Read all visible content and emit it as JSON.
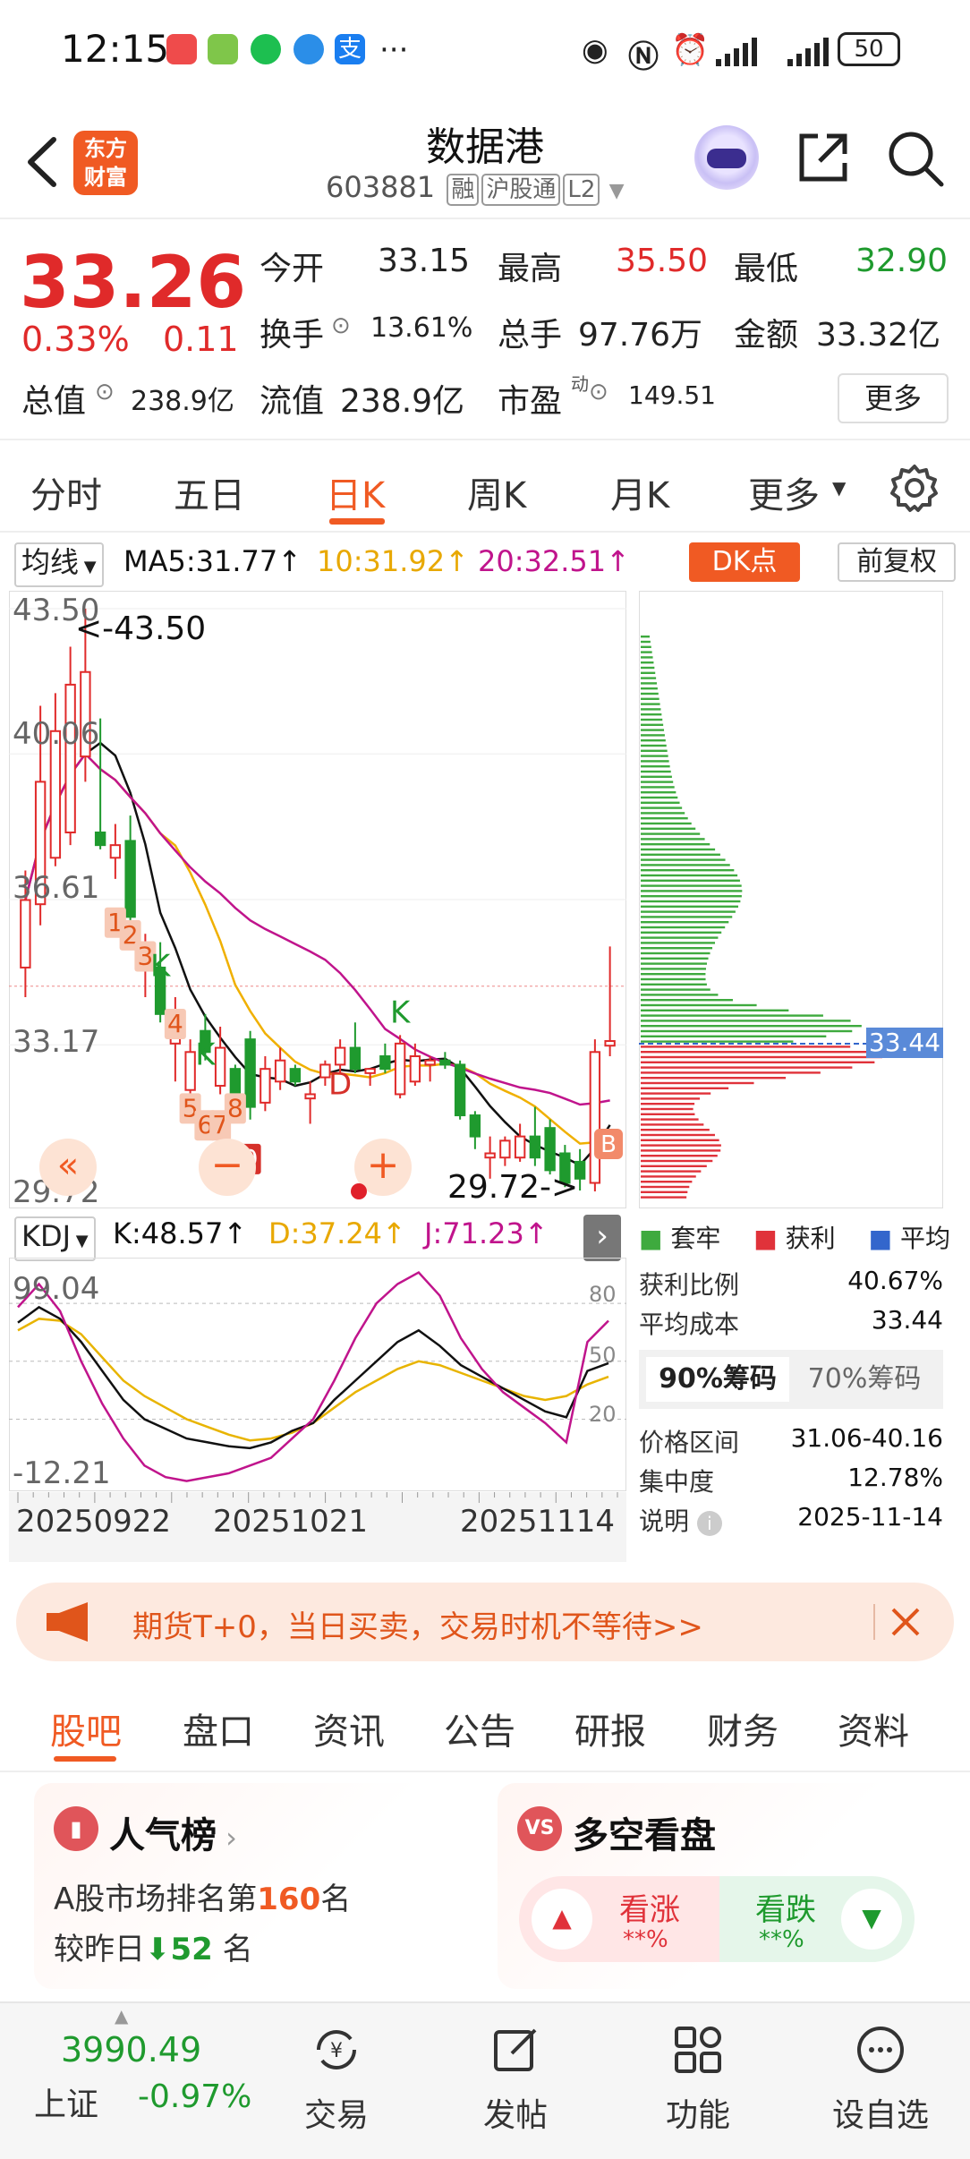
{
  "status_bar": {
    "time": "12:15",
    "battery": "50",
    "icons": [
      "notification-app-icon",
      "wifi-app-icon",
      "wechat-icon",
      "location-icon",
      "alipay-icon",
      "more-dots-icon",
      "eye-icon",
      "nfc-icon",
      "alarm-icon",
      "signal-icon",
      "signal-icon"
    ]
  },
  "header": {
    "name": "数据港",
    "code": "603881",
    "tags": [
      "融",
      "沪股通",
      "L2"
    ],
    "brand": "东方财富"
  },
  "quote": {
    "price": "33.26",
    "change_pct": "0.33%",
    "change": "0.11",
    "open_label": "今开",
    "open": "33.15",
    "high_label": "最高",
    "high": "35.50",
    "low_label": "最低",
    "low": "32.90",
    "turnover_label": "换手",
    "turnover": "13.61%",
    "volume_label": "总手",
    "volume": "97.76万",
    "amount_label": "金额",
    "amount": "33.32亿",
    "mktcap_label": "总值",
    "mktcap": "238.9亿",
    "float_label": "流值",
    "float": "238.9亿",
    "pe_label": "市盈",
    "pe_sup": "动",
    "pe": "149.51",
    "more": "更多"
  },
  "periods": [
    "分时",
    "五日",
    "日K",
    "周K",
    "月K",
    "更多"
  ],
  "ma_row": {
    "selector": "均线",
    "ma5": "MA5:31.77↑",
    "ma10": "10:31.92↑",
    "ma20": "20:32.51↑",
    "dk": "DK点",
    "adjust": "前复权"
  },
  "kchart": {
    "y_labels": [
      "43.50",
      "40.06",
      "36.61",
      "33.17",
      "29.72"
    ],
    "high_marker": "<-43.50",
    "low_marker": "29.72->",
    "td_numbers": [
      "1",
      "2",
      "3",
      "4",
      "5",
      "6",
      "7",
      "8",
      "9"
    ],
    "letters": [
      "K",
      "K",
      "K",
      "D"
    ],
    "b_marker": "B",
    "colors": {
      "up": "#e02a2a",
      "down": "#1f9a2e",
      "ma5": "#111111",
      "ma10": "#f0b000",
      "ma20": "#c0148c"
    }
  },
  "chart_data": {
    "type": "candlestick",
    "ylim": [
      29.72,
      43.5
    ],
    "candles": [
      {
        "o": 35.0,
        "h": 37.3,
        "l": 34.3,
        "c": 36.6
      },
      {
        "o": 36.5,
        "h": 41.2,
        "l": 36.0,
        "c": 39.4
      },
      {
        "o": 37.6,
        "h": 41.5,
        "l": 37.4,
        "c": 40.6
      },
      {
        "o": 38.2,
        "h": 42.6,
        "l": 37.9,
        "c": 41.7
      },
      {
        "o": 40.0,
        "h": 43.5,
        "l": 39.4,
        "c": 42.0
      },
      {
        "o": 38.2,
        "h": 40.9,
        "l": 37.8,
        "c": 37.9
      },
      {
        "o": 37.6,
        "h": 38.4,
        "l": 37.1,
        "c": 37.9
      },
      {
        "o": 38.0,
        "h": 38.6,
        "l": 35.9,
        "c": 36.2
      },
      {
        "o": 35.0,
        "h": 35.8,
        "l": 34.3,
        "c": 35.6
      },
      {
        "o": 35.0,
        "h": 35.6,
        "l": 33.7,
        "c": 33.9
      },
      {
        "o": 33.2,
        "h": 34.3,
        "l": 32.3,
        "c": 33.7
      },
      {
        "o": 32.1,
        "h": 33.3,
        "l": 31.9,
        "c": 33.0
      },
      {
        "o": 33.5,
        "h": 33.9,
        "l": 32.8,
        "c": 33.0
      },
      {
        "o": 32.2,
        "h": 33.6,
        "l": 32.0,
        "c": 33.1
      },
      {
        "o": 32.6,
        "h": 32.7,
        "l": 31.5,
        "c": 31.6
      },
      {
        "o": 33.3,
        "h": 33.5,
        "l": 31.4,
        "c": 31.7
      },
      {
        "o": 31.8,
        "h": 32.9,
        "l": 31.6,
        "c": 32.6
      },
      {
        "o": 32.3,
        "h": 33.1,
        "l": 32.1,
        "c": 32.8
      },
      {
        "o": 32.6,
        "h": 32.7,
        "l": 32.2,
        "c": 32.3
      },
      {
        "o": 31.9,
        "h": 32.3,
        "l": 31.3,
        "c": 32.0
      },
      {
        "o": 32.4,
        "h": 32.8,
        "l": 32.2,
        "c": 32.7
      },
      {
        "o": 32.7,
        "h": 33.3,
        "l": 32.5,
        "c": 33.1
      },
      {
        "o": 33.1,
        "h": 33.7,
        "l": 32.5,
        "c": 32.6
      },
      {
        "o": 32.5,
        "h": 32.6,
        "l": 32.2,
        "c": 32.6
      },
      {
        "o": 32.9,
        "h": 33.2,
        "l": 32.5,
        "c": 32.6
      },
      {
        "o": 32.0,
        "h": 33.4,
        "l": 31.9,
        "c": 33.2
      },
      {
        "o": 32.3,
        "h": 33.2,
        "l": 32.2,
        "c": 32.9
      },
      {
        "o": 32.7,
        "h": 32.9,
        "l": 32.3,
        "c": 32.8
      },
      {
        "o": 32.8,
        "h": 33.0,
        "l": 32.6,
        "c": 32.7
      },
      {
        "o": 32.7,
        "h": 32.8,
        "l": 31.4,
        "c": 31.5
      },
      {
        "o": 31.5,
        "h": 31.6,
        "l": 30.7,
        "c": 31.0
      },
      {
        "o": 30.5,
        "h": 31.0,
        "l": 30.0,
        "c": 30.6
      },
      {
        "o": 30.5,
        "h": 31.0,
        "l": 30.3,
        "c": 30.9
      },
      {
        "o": 30.5,
        "h": 31.3,
        "l": 30.4,
        "c": 31.0
      },
      {
        "o": 31.0,
        "h": 31.7,
        "l": 30.3,
        "c": 30.5
      },
      {
        "o": 31.2,
        "h": 31.4,
        "l": 30.1,
        "c": 30.2
      },
      {
        "o": 30.6,
        "h": 30.8,
        "l": 29.8,
        "c": 29.9
      },
      {
        "o": 30.4,
        "h": 30.7,
        "l": 29.72,
        "c": 30.0
      },
      {
        "o": 29.9,
        "h": 33.3,
        "l": 29.7,
        "c": 33.0
      },
      {
        "o": 33.15,
        "h": 35.5,
        "l": 32.9,
        "c": 33.26
      }
    ],
    "kdj": {
      "ylim": [
        -12.21,
        99.04
      ],
      "ref_labels": [
        "80",
        "50",
        "20"
      ],
      "k": [
        70,
        78,
        72,
        60,
        45,
        30,
        20,
        15,
        10,
        8,
        6,
        5,
        8,
        14,
        18,
        30,
        40,
        50,
        60,
        66,
        58,
        48,
        42,
        36,
        30,
        24,
        21,
        45,
        49
      ],
      "d": [
        66,
        72,
        71,
        64,
        52,
        40,
        32,
        26,
        20,
        16,
        12,
        9,
        10,
        13,
        18,
        26,
        34,
        40,
        46,
        50,
        48,
        44,
        40,
        36,
        32,
        30,
        32,
        38,
        42
      ],
      "j": [
        78,
        90,
        76,
        50,
        28,
        10,
        -4,
        -10,
        -12,
        -10,
        -8,
        -4,
        0,
        10,
        20,
        40,
        62,
        80,
        90,
        96,
        84,
        62,
        46,
        34,
        26,
        18,
        8,
        60,
        71
      ]
    },
    "x_labels": [
      "20250922",
      "20251021",
      "20251114"
    ]
  },
  "kdj_row": {
    "selector": "KDJ",
    "k": "K:48.57↑",
    "d": "D:37.24↑",
    "j": "J:71.23↑",
    "y_top": "99.04",
    "y_bottom": "-12.21"
  },
  "chips": {
    "avg_price_tag": "33.44",
    "legend": [
      "套牢",
      "获利",
      "平均"
    ],
    "legend_colors": [
      "#3eaa3e",
      "#e0323a",
      "#3366cc"
    ],
    "profit_ratio_label": "获利比例",
    "profit_ratio": "40.67%",
    "avg_cost_label": "平均成本",
    "avg_cost": "33.44",
    "tab90": "90%筹码",
    "tab70": "70%筹码",
    "range_label": "价格区间",
    "range": "31.06-40.16",
    "concentration_label": "集中度",
    "concentration": "12.78%",
    "note_label": "说明",
    "note_date": "2025-11-14"
  },
  "banner": {
    "text": "期货T+0，当日买卖，交易时机不等待>>"
  },
  "content_tabs": [
    "股吧",
    "盘口",
    "资讯",
    "公告",
    "研报",
    "财务",
    "资料"
  ],
  "popularity": {
    "title": "人气榜",
    "rank_prefix": "A股市场排名第",
    "rank": "160",
    "rank_suffix": "名",
    "compare_prefix": "较昨日",
    "change": "52",
    "compare_suffix": "名"
  },
  "sentiment": {
    "title": "多空看盘",
    "bull": "看涨",
    "bull_pct": "**%",
    "bear": "看跌",
    "bear_pct": "**%"
  },
  "bottom_nav": {
    "index_value": "3990.49",
    "index_name": "上证",
    "index_change": "-0.97%",
    "items": [
      "交易",
      "发帖",
      "功能",
      "设自选"
    ]
  }
}
